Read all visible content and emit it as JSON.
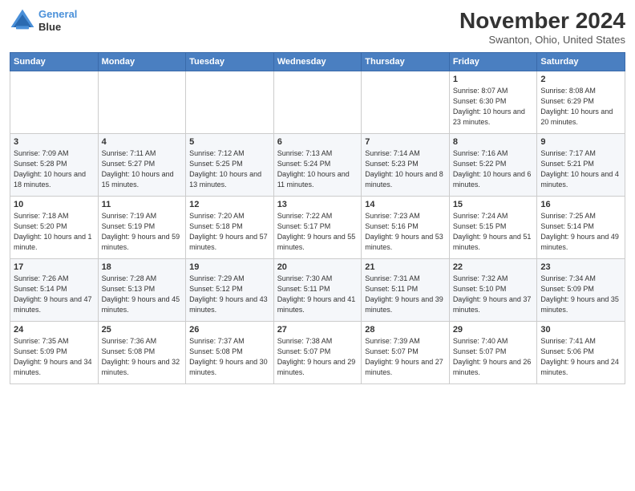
{
  "header": {
    "logo_line1": "General",
    "logo_line2": "Blue",
    "month": "November 2024",
    "location": "Swanton, Ohio, United States"
  },
  "days_of_week": [
    "Sunday",
    "Monday",
    "Tuesday",
    "Wednesday",
    "Thursday",
    "Friday",
    "Saturday"
  ],
  "weeks": [
    [
      {
        "day": "",
        "info": ""
      },
      {
        "day": "",
        "info": ""
      },
      {
        "day": "",
        "info": ""
      },
      {
        "day": "",
        "info": ""
      },
      {
        "day": "",
        "info": ""
      },
      {
        "day": "1",
        "info": "Sunrise: 8:07 AM\nSunset: 6:30 PM\nDaylight: 10 hours and 23 minutes."
      },
      {
        "day": "2",
        "info": "Sunrise: 8:08 AM\nSunset: 6:29 PM\nDaylight: 10 hours and 20 minutes."
      }
    ],
    [
      {
        "day": "3",
        "info": "Sunrise: 7:09 AM\nSunset: 5:28 PM\nDaylight: 10 hours and 18 minutes."
      },
      {
        "day": "4",
        "info": "Sunrise: 7:11 AM\nSunset: 5:27 PM\nDaylight: 10 hours and 15 minutes."
      },
      {
        "day": "5",
        "info": "Sunrise: 7:12 AM\nSunset: 5:25 PM\nDaylight: 10 hours and 13 minutes."
      },
      {
        "day": "6",
        "info": "Sunrise: 7:13 AM\nSunset: 5:24 PM\nDaylight: 10 hours and 11 minutes."
      },
      {
        "day": "7",
        "info": "Sunrise: 7:14 AM\nSunset: 5:23 PM\nDaylight: 10 hours and 8 minutes."
      },
      {
        "day": "8",
        "info": "Sunrise: 7:16 AM\nSunset: 5:22 PM\nDaylight: 10 hours and 6 minutes."
      },
      {
        "day": "9",
        "info": "Sunrise: 7:17 AM\nSunset: 5:21 PM\nDaylight: 10 hours and 4 minutes."
      }
    ],
    [
      {
        "day": "10",
        "info": "Sunrise: 7:18 AM\nSunset: 5:20 PM\nDaylight: 10 hours and 1 minute."
      },
      {
        "day": "11",
        "info": "Sunrise: 7:19 AM\nSunset: 5:19 PM\nDaylight: 9 hours and 59 minutes."
      },
      {
        "day": "12",
        "info": "Sunrise: 7:20 AM\nSunset: 5:18 PM\nDaylight: 9 hours and 57 minutes."
      },
      {
        "day": "13",
        "info": "Sunrise: 7:22 AM\nSunset: 5:17 PM\nDaylight: 9 hours and 55 minutes."
      },
      {
        "day": "14",
        "info": "Sunrise: 7:23 AM\nSunset: 5:16 PM\nDaylight: 9 hours and 53 minutes."
      },
      {
        "day": "15",
        "info": "Sunrise: 7:24 AM\nSunset: 5:15 PM\nDaylight: 9 hours and 51 minutes."
      },
      {
        "day": "16",
        "info": "Sunrise: 7:25 AM\nSunset: 5:14 PM\nDaylight: 9 hours and 49 minutes."
      }
    ],
    [
      {
        "day": "17",
        "info": "Sunrise: 7:26 AM\nSunset: 5:14 PM\nDaylight: 9 hours and 47 minutes."
      },
      {
        "day": "18",
        "info": "Sunrise: 7:28 AM\nSunset: 5:13 PM\nDaylight: 9 hours and 45 minutes."
      },
      {
        "day": "19",
        "info": "Sunrise: 7:29 AM\nSunset: 5:12 PM\nDaylight: 9 hours and 43 minutes."
      },
      {
        "day": "20",
        "info": "Sunrise: 7:30 AM\nSunset: 5:11 PM\nDaylight: 9 hours and 41 minutes."
      },
      {
        "day": "21",
        "info": "Sunrise: 7:31 AM\nSunset: 5:11 PM\nDaylight: 9 hours and 39 minutes."
      },
      {
        "day": "22",
        "info": "Sunrise: 7:32 AM\nSunset: 5:10 PM\nDaylight: 9 hours and 37 minutes."
      },
      {
        "day": "23",
        "info": "Sunrise: 7:34 AM\nSunset: 5:09 PM\nDaylight: 9 hours and 35 minutes."
      }
    ],
    [
      {
        "day": "24",
        "info": "Sunrise: 7:35 AM\nSunset: 5:09 PM\nDaylight: 9 hours and 34 minutes."
      },
      {
        "day": "25",
        "info": "Sunrise: 7:36 AM\nSunset: 5:08 PM\nDaylight: 9 hours and 32 minutes."
      },
      {
        "day": "26",
        "info": "Sunrise: 7:37 AM\nSunset: 5:08 PM\nDaylight: 9 hours and 30 minutes."
      },
      {
        "day": "27",
        "info": "Sunrise: 7:38 AM\nSunset: 5:07 PM\nDaylight: 9 hours and 29 minutes."
      },
      {
        "day": "28",
        "info": "Sunrise: 7:39 AM\nSunset: 5:07 PM\nDaylight: 9 hours and 27 minutes."
      },
      {
        "day": "29",
        "info": "Sunrise: 7:40 AM\nSunset: 5:07 PM\nDaylight: 9 hours and 26 minutes."
      },
      {
        "day": "30",
        "info": "Sunrise: 7:41 AM\nSunset: 5:06 PM\nDaylight: 9 hours and 24 minutes."
      }
    ]
  ]
}
